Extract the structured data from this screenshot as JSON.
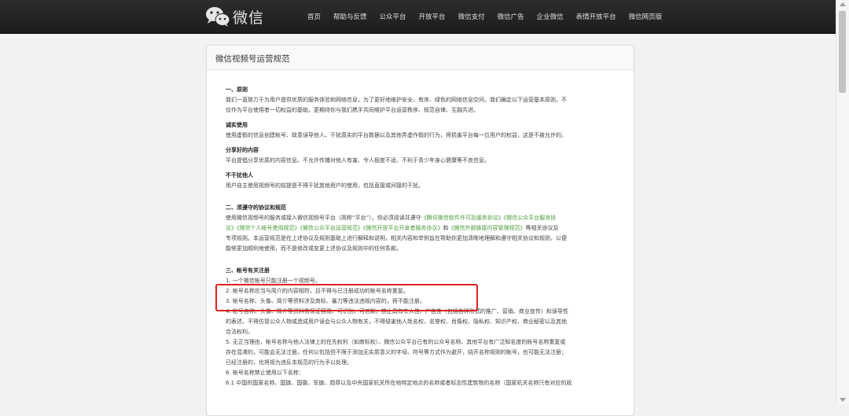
{
  "header": {
    "logo_text": "微信",
    "nav": [
      "首页",
      "帮助与反馈",
      "公众平台",
      "开放平台",
      "微信支付",
      "微信广告",
      "企业微信",
      "表情开放平台",
      "微信网页版"
    ]
  },
  "page": {
    "title": "微信视频号运营规范",
    "s1_title": "一、原则",
    "s1_l1": "我们一直致力于为用户提供优质的服务体验和网络信息，为了更好地维护安全、有序、绿色的网络信息空间，我们确定以下运营基本原则，不",
    "s1_l2": "仅作为平台使用者一切权益的基础，更期待你与我们携手共同维护平台运营秩序、规范自律、互融共进。",
    "h_integrity": "诚实使用",
    "p_integrity": "使用虚假的信息创建帐号、故意误导他人、干扰真实的平台数据以及其他弄虚作假的行为，将损害平台每一位用户的权益，这是不被允许的。",
    "h_share": "分享好的内容",
    "p_share": "平台提倡分享优质的内容信息。不允许传播对他人有害、令人极度不适、不利于青少年身心健康等不良信息。",
    "h_nodisturb": "不干扰他人",
    "p_nodisturb": "用户自主使用视频号的前提是不得干扰其他用户的使用，包括直接或间接的干扰。",
    "s2_title": "二、须遵守的协议和规范",
    "s2_l1_a": "使用微信视频号的服务或接入微信视频号平台（简称“平台”），你必须阅读并遵守",
    "s2_l1_b": "《腾讯微信软件许可及服务协议》《微信公众平台服务协",
    "s2_l2_a": "议》《微信个人帐号使用规范》《微信公众平台运营规范》《微信开放平台开发者服务协议》",
    "s2_l2_b": "和",
    "s2_l2_c": "《微信外部链接内容管理规范》",
    "s2_l2_d": "等相关协议及",
    "s2_l3": "专项规则。本运营规范是在上述协议及规则基础上进行解释和说明，相关内容和举例旨在帮助你更加清晰地理解和遵守相关协议和规则，以便",
    "s2_l4": "能够更加顺利地使用，而不是修改或变更上述协议及规则中的任何条款。",
    "s3_title": "三、帐号有关注册",
    "r1": "1. 一个微信帐号只能注册一个视频号。",
    "r2": "2. 帐号名称应当与简介的内容相符，且不得与已注册成功的帐号名称重复。",
    "r3": "3. 帐号名称、头像、简介等资料涉及商标、暴力等违法违规内容的，将不能注册。",
    "r4_l1": "4. 帐号名称、头像、简介等资料需保证客观、可识别、可信赖，禁止具有夸大性、广告性（包括各种形式的推广、营销、商业宣传）和误导性",
    "r4_l2": "的表述。不得仿冒公众人物或造成用户误会与公众人物有关，不得侵害他人姓名权、名誉权、肖像权、隐私权、知识产权、商业秘密以及其他",
    "r4_l3": "合法权利。",
    "r5_l1": "5. 无正当理由，帐号名称与他人法律上的在先权利（如商标权）、微信公众平台已有的公众号名称、其他平台有广泛知名度的帐号名称重复或",
    "r5_l2": "存在混淆的，可能会无法注册。任何以包括但不限于添加无实质意义的字母、符号等方式作为避开，绕开名称规则的帐号，也可能无法注册；",
    "r5_l3": "已经注册的，也将视为违反本规范的行为予以处理。",
    "r6": "6. 帐号名称禁止使用以下名称：",
    "r61": "6.1 中国的国家名称、国旗、国徽、军旗、勋章以及中央国家机关所在地特定地点的名称或者标志性建筑物的名称（国家机关名称只有对应的政"
  },
  "colors": {
    "link_green": "#4a9a3a",
    "highlight_red": "#e02020"
  }
}
